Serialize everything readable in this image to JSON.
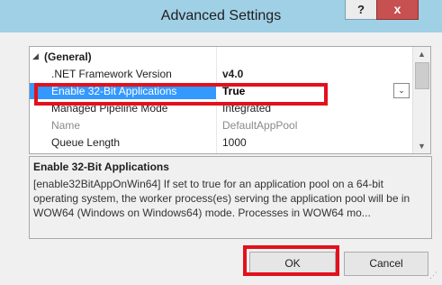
{
  "window": {
    "title": "Advanced Settings",
    "help_label": "?",
    "close_label": "x"
  },
  "grid": {
    "category": {
      "name": "(General)",
      "toggle": "◢"
    },
    "rows": [
      {
        "name": ".NET Framework Version",
        "value": "v4.0"
      },
      {
        "name": "Enable 32-Bit Applications",
        "value": "True"
      },
      {
        "name": "Managed Pipeline Mode",
        "value": "Integrated"
      },
      {
        "name": "Name",
        "value": "DefaultAppPool"
      },
      {
        "name": "Queue Length",
        "value": "1000"
      }
    ],
    "dropdown_glyph": "⌄"
  },
  "description": {
    "title": "Enable 32-Bit Applications",
    "text": "[enable32BitAppOnWin64] If set to true for an application pool on a 64-bit operating system, the worker process(es) serving the application pool will be in WOW64 (Windows on Windows64) mode. Processes in WOW64 mo..."
  },
  "buttons": {
    "ok": "OK",
    "cancel": "Cancel"
  },
  "colors": {
    "titlebar": "#a0d0e6",
    "selection": "#3399ff",
    "highlight": "#e3101e"
  }
}
